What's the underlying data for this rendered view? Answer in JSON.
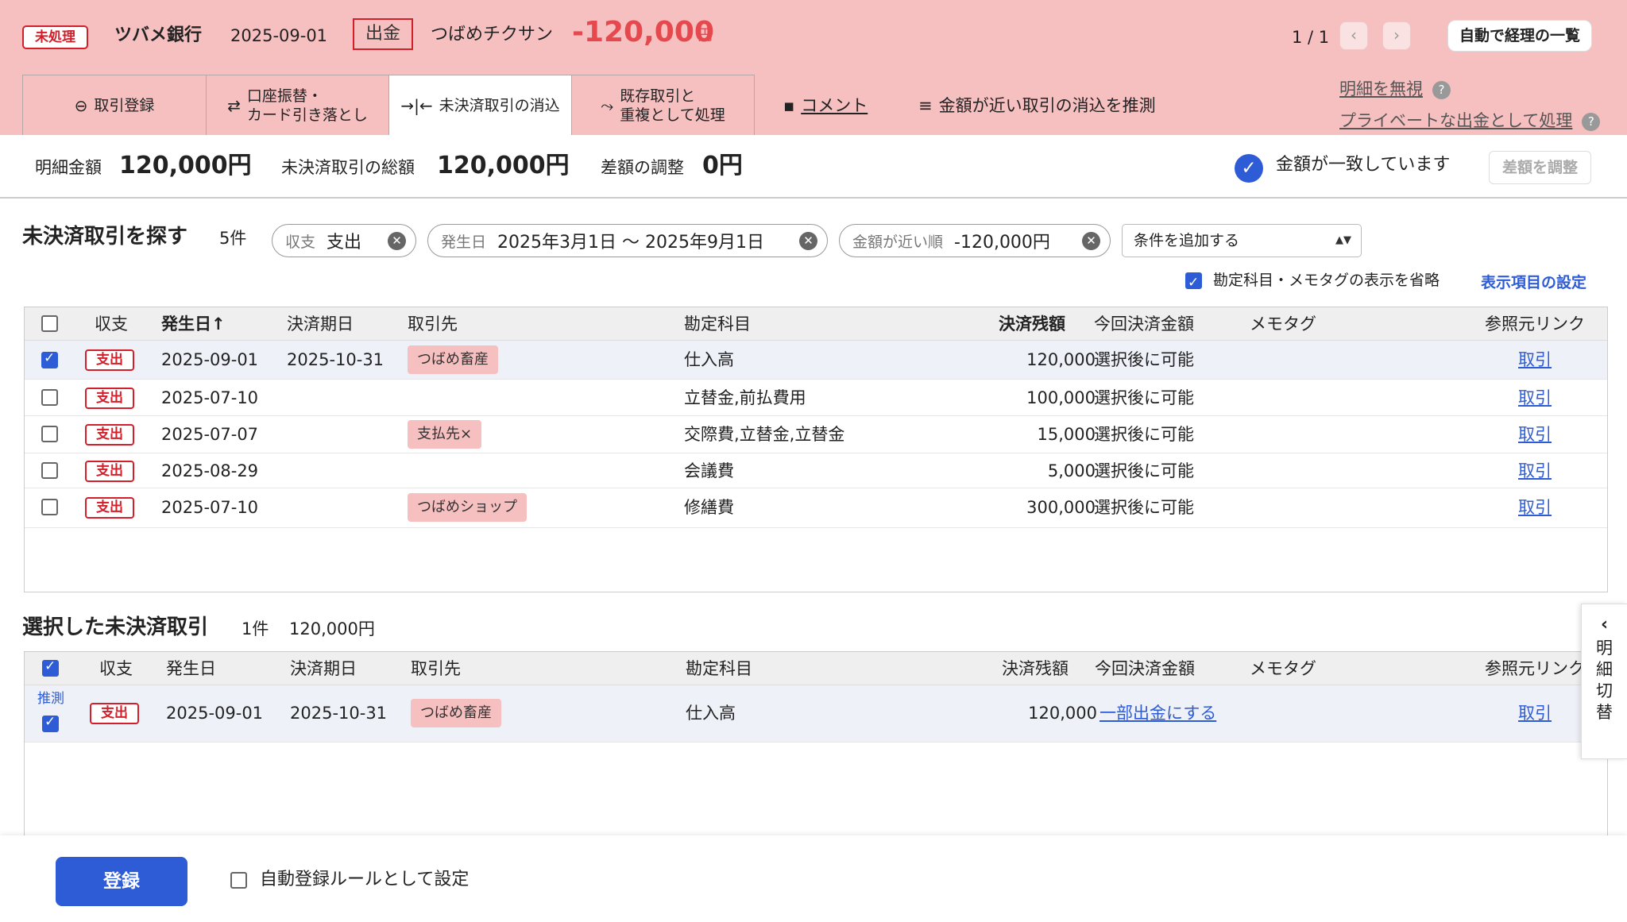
{
  "header": {
    "status_badge": "未処理",
    "bank_name": "ツバメ銀行",
    "date": "2025-09-01",
    "direction": "出金",
    "partner": "つばめチクサン",
    "amount": "-120,000",
    "currency_unit": "円",
    "pager": "1 / 1",
    "prev_icon": "chevron-left-icon",
    "next_icon": "chevron-right-icon",
    "auto_list_button": "自動で経理の一覧"
  },
  "tabs": [
    {
      "icon": "minus-circle-icon",
      "label": "取引登録"
    },
    {
      "icon": "transfer-icon",
      "label_line1": "口座振替・",
      "label_line2": "カード引き落とし"
    },
    {
      "icon": "reconcile-icon",
      "label": "未決済取引の消込",
      "active": true
    },
    {
      "icon": "merge-icon",
      "label_line1": "既存取引と",
      "label_line2": "重複として処理"
    }
  ],
  "tab_links": {
    "comment": "コメント",
    "guess": "金額が近い取引の消込を推測",
    "ignore": "明細を無視",
    "private_expense": "プライベートな出金として処理"
  },
  "summary": {
    "statement_amount_label": "明細金額",
    "statement_amount": "120,000円",
    "unsettled_total_label": "未決済取引の総額",
    "unsettled_total": "120,000円",
    "diff_label": "差額の調整",
    "diff": "0円",
    "match_text": "金額が一致しています",
    "adjust_button": "差額を調整"
  },
  "search": {
    "title": "未決済取引を探す",
    "count": "5件",
    "chips": [
      {
        "label": "収支",
        "value": "支出"
      },
      {
        "label": "発生日",
        "value": "2025年3月1日 〜 2025年9月1日"
      },
      {
        "label": "金額が近い順",
        "value": "-120,000円"
      }
    ],
    "add_condition": "条件を追加する",
    "omit_label": "勘定科目・メモタグの表示を省略",
    "column_settings": "表示項目の設定"
  },
  "table": {
    "headers": [
      "収支",
      "発生日",
      "決済期日",
      "取引先",
      "勘定科目",
      "決済残額",
      "今回決済金額",
      "メモタグ",
      "参照元リンク"
    ],
    "sort_indicator": "↑",
    "rows": [
      {
        "type": "支出",
        "date": "2025-09-01",
        "due": "2025-10-31",
        "partner": "つばめ畜産",
        "account": "仕入高",
        "balance": "120,000",
        "this_amount": "選択後に可能",
        "memo": "",
        "link": "取引",
        "checked": true
      },
      {
        "type": "支出",
        "date": "2025-07-10",
        "due": "",
        "partner": "",
        "account": "立替金,前払費用",
        "balance": "100,000",
        "this_amount": "選択後に可能",
        "memo": "",
        "link": "取引",
        "checked": false
      },
      {
        "type": "支出",
        "date": "2025-07-07",
        "due": "",
        "partner": "支払先×",
        "account": "交際費,立替金,立替金",
        "balance": "15,000",
        "this_amount": "選択後に可能",
        "memo": "",
        "link": "取引",
        "checked": false
      },
      {
        "type": "支出",
        "date": "2025-08-29",
        "due": "",
        "partner": "",
        "account": "会議費",
        "balance": "5,000",
        "this_amount": "選択後に可能",
        "memo": "",
        "link": "取引",
        "checked": false
      },
      {
        "type": "支出",
        "date": "2025-07-10",
        "due": "",
        "partner": "つばめショップ",
        "account": "修繕費",
        "balance": "300,000",
        "this_amount": "選択後に可能",
        "memo": "",
        "link": "取引",
        "checked": false
      }
    ]
  },
  "selected": {
    "title": "選択した未決済取引",
    "count": "1件",
    "total": "120,000円",
    "headers": [
      "収支",
      "発生日",
      "決済期日",
      "取引先",
      "勘定科目",
      "決済残額",
      "今回決済金額",
      "メモタグ",
      "参照元リンク"
    ],
    "rows": [
      {
        "guess_label": "推測",
        "type": "支出",
        "date": "2025-09-01",
        "due": "2025-10-31",
        "partner": "つばめ畜産",
        "account": "仕入高",
        "balance": "120,000",
        "this_amount": "一部出金にする",
        "memo": "",
        "link": "取引"
      }
    ]
  },
  "side_tab": {
    "icon": "chevron-left-icon",
    "label": "明細切替"
  },
  "footer": {
    "register_button": "登録",
    "auto_rule_label": "自動登録ルールとして設定"
  },
  "colors": {
    "header_bg": "#f6bfc0",
    "accent_red": "#d21f2a",
    "amount_red": "#e5484d",
    "primary_blue": "#2e5cd6"
  }
}
